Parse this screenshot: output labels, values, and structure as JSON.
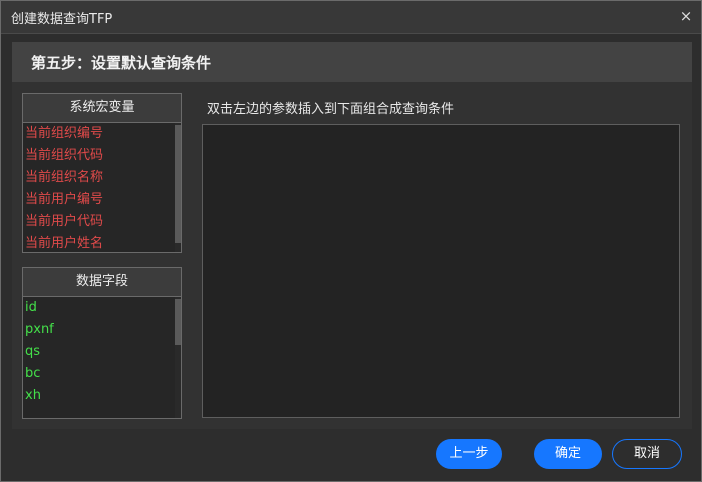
{
  "window": {
    "title": "创建数据查询TFP",
    "close_glyph": "×"
  },
  "step": {
    "title": "第五步：设置默认查询条件"
  },
  "macro_panel": {
    "header": "系统宏变量",
    "items": [
      {
        "label": "当前组织编号"
      },
      {
        "label": "当前组织代码"
      },
      {
        "label": "当前组织名称"
      },
      {
        "label": "当前用户编号"
      },
      {
        "label": "当前用户代码"
      },
      {
        "label": "当前用户姓名"
      }
    ]
  },
  "field_panel": {
    "header": "数据字段",
    "items": [
      {
        "label": "id"
      },
      {
        "label": "pxnf"
      },
      {
        "label": "qs"
      },
      {
        "label": "bc"
      },
      {
        "label": "xh"
      }
    ]
  },
  "condition": {
    "hint": "双击左边的参数插入到下面组合成查询条件",
    "value": ""
  },
  "buttons": {
    "prev": "上一步",
    "ok": "确定",
    "cancel": "取消"
  },
  "colors": {
    "accent": "#1677ff",
    "macro_text": "#e04a4a",
    "field_text": "#44e04a"
  }
}
